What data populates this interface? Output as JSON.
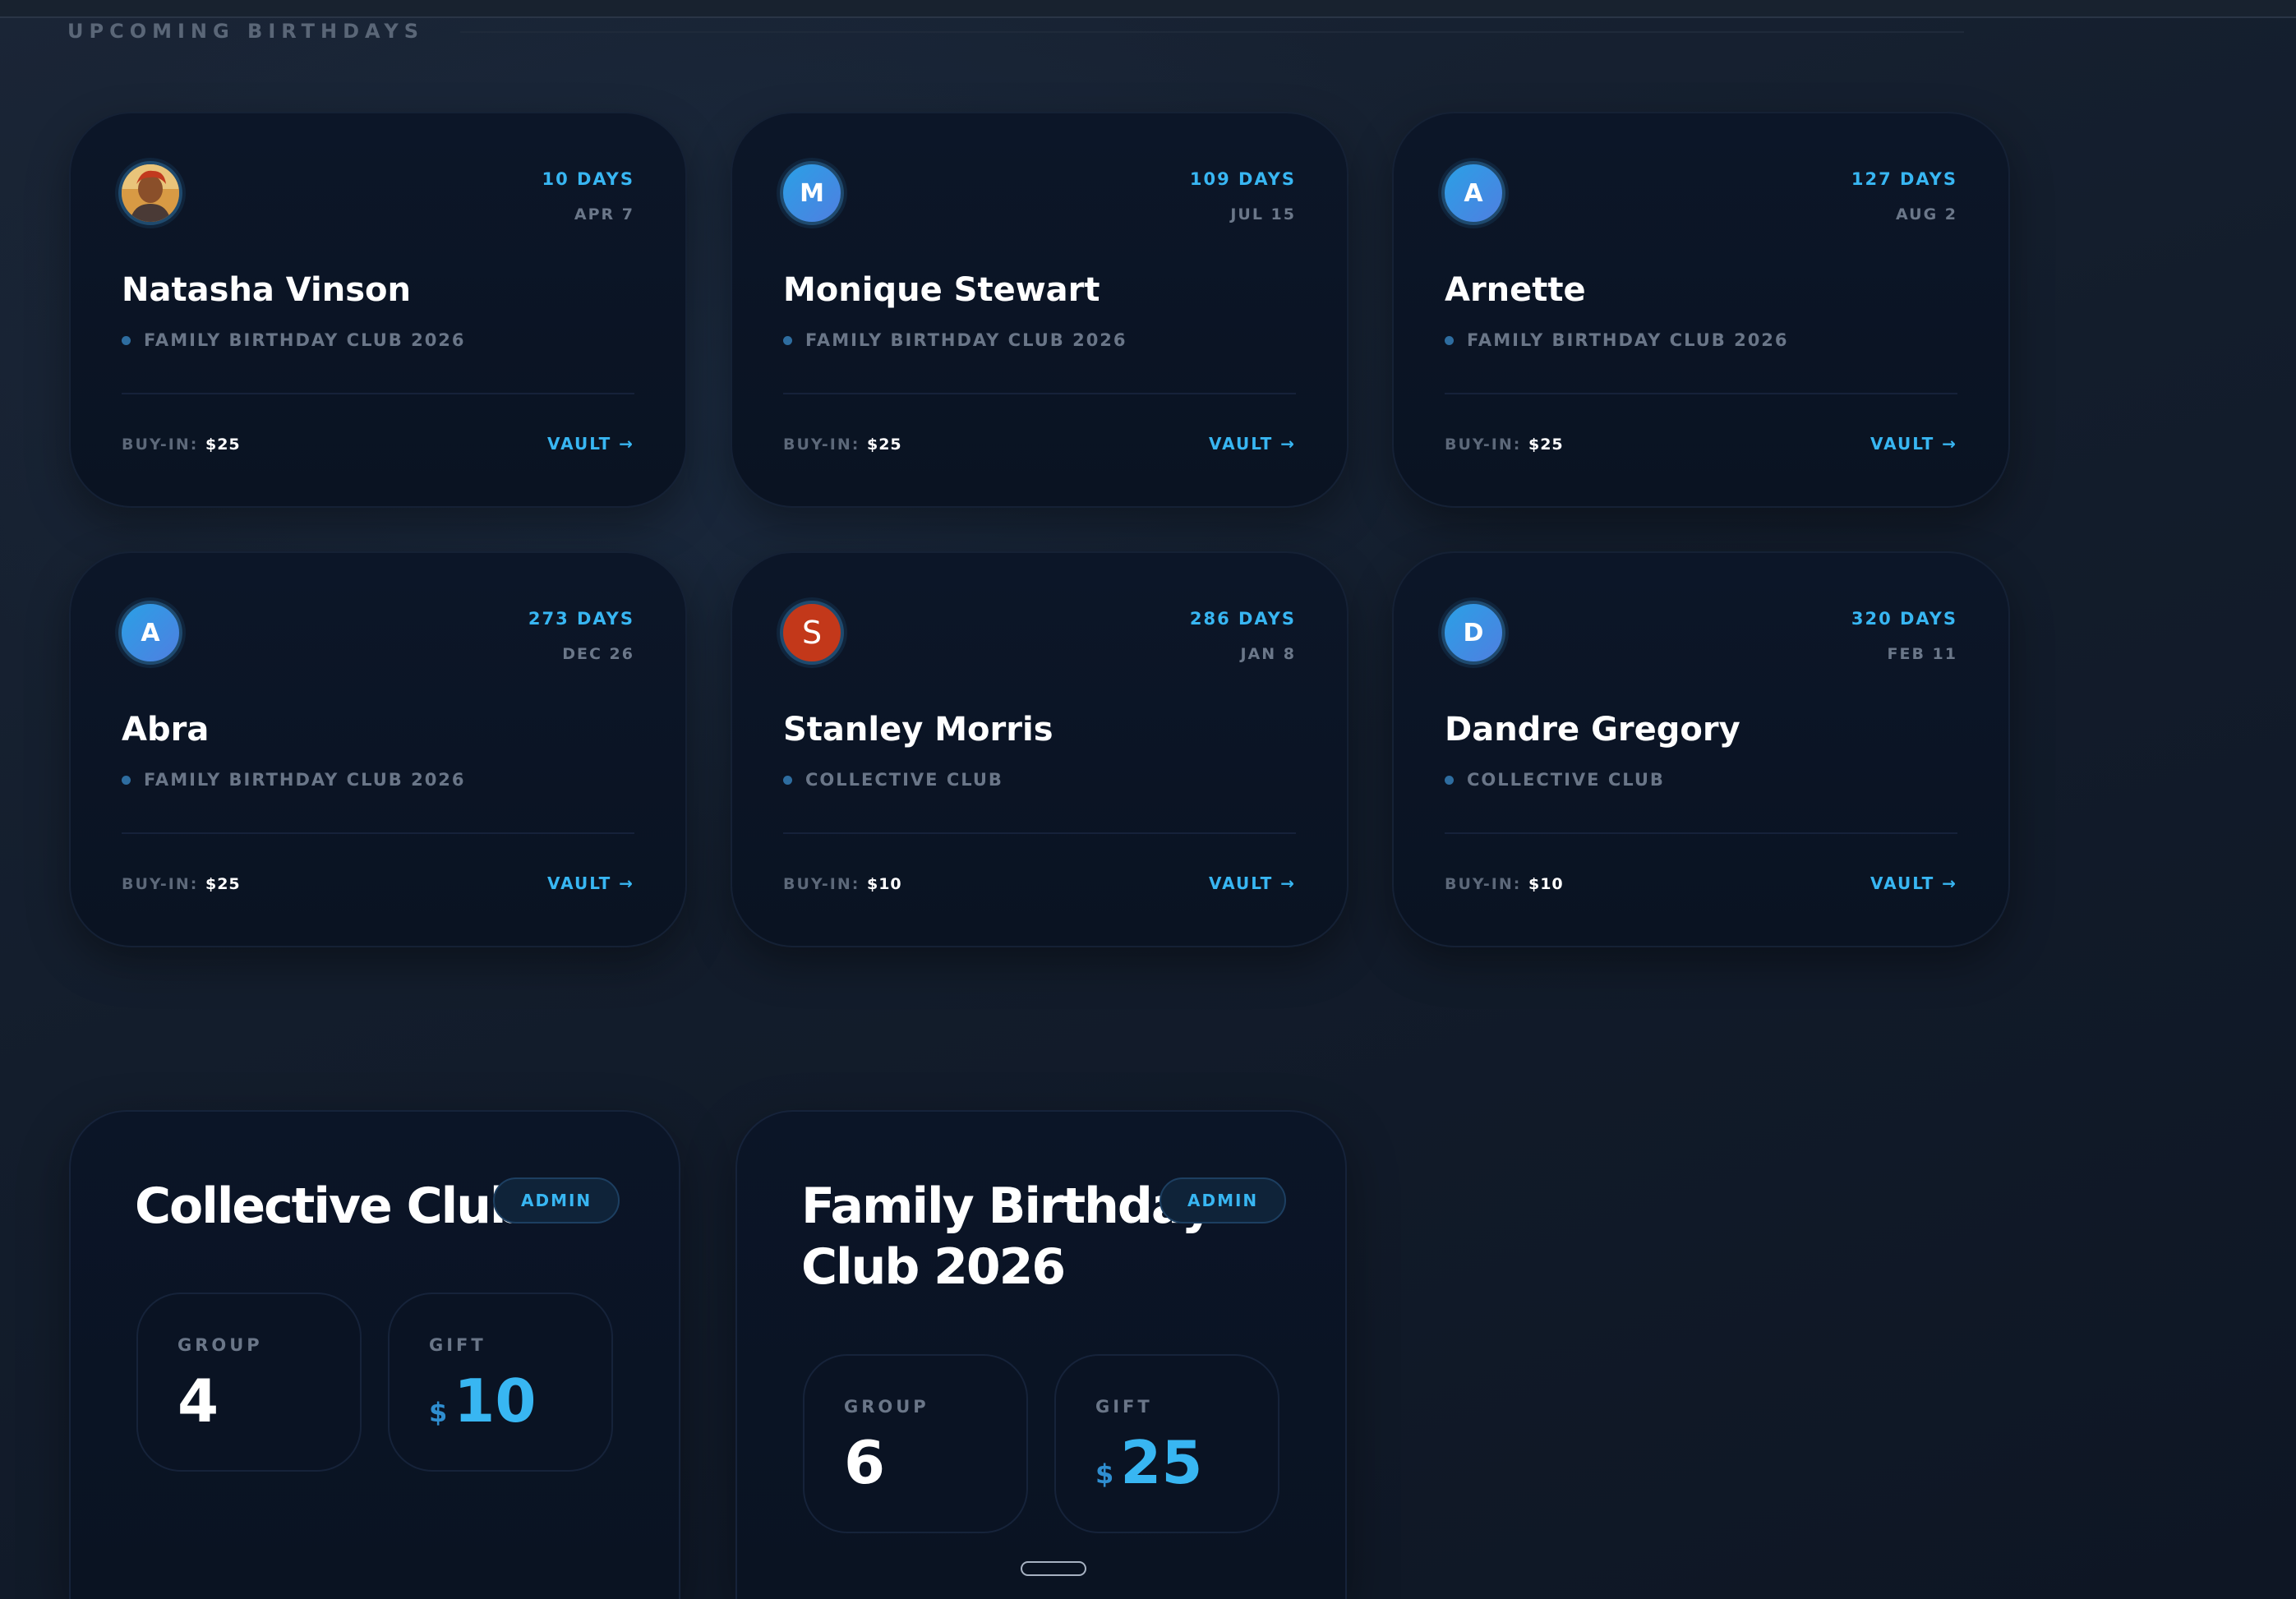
{
  "section": {
    "title": "UPCOMING BIRTHDAYS"
  },
  "birthdays": [
    {
      "name": "Natasha Vinson",
      "days": "10 DAYS",
      "date": "APR 7",
      "club": "FAMILY BIRTHDAY CLUB 2026",
      "buyin_label": "BUY-IN:",
      "buyin_value": "$25",
      "vault_label": "VAULT →",
      "avatar_letter": "",
      "avatar_type": "photo"
    },
    {
      "name": "Monique Stewart",
      "days": "109 DAYS",
      "date": "JUL 15",
      "club": "FAMILY BIRTHDAY CLUB 2026",
      "buyin_label": "BUY-IN:",
      "buyin_value": "$25",
      "vault_label": "VAULT →",
      "avatar_letter": "M",
      "avatar_type": "initial"
    },
    {
      "name": "Arnette",
      "days": "127 DAYS",
      "date": "AUG 2",
      "club": "FAMILY BIRTHDAY CLUB 2026",
      "buyin_label": "BUY-IN:",
      "buyin_value": "$25",
      "vault_label": "VAULT →",
      "avatar_letter": "A",
      "avatar_type": "initial"
    },
    {
      "name": "Abra",
      "days": "273 DAYS",
      "date": "DEC 26",
      "club": "FAMILY BIRTHDAY CLUB 2026",
      "buyin_label": "BUY-IN:",
      "buyin_value": "$25",
      "vault_label": "VAULT →",
      "avatar_letter": "A",
      "avatar_type": "initial"
    },
    {
      "name": "Stanley Morris",
      "days": "286 DAYS",
      "date": "JAN 8",
      "club": "COLLECTIVE CLUB",
      "buyin_label": "BUY-IN:",
      "buyin_value": "$10",
      "vault_label": "VAULT →",
      "avatar_letter": "S",
      "avatar_type": "red"
    },
    {
      "name": "Dandre Gregory",
      "days": "320 DAYS",
      "date": "FEB 11",
      "club": "COLLECTIVE CLUB",
      "buyin_label": "BUY-IN:",
      "buyin_value": "$10",
      "vault_label": "VAULT →",
      "avatar_letter": "D",
      "avatar_type": "initial"
    }
  ],
  "clubs": [
    {
      "title_line1": "Collective Club",
      "title_line2": "",
      "admin_label": "ADMIN",
      "group_label": "GROUP",
      "group_value": "4",
      "gift_label": "GIFT",
      "currency": "$",
      "gift_value": "10"
    },
    {
      "title_line1": "Family Birthday",
      "title_line2": "Club 2026",
      "admin_label": "ADMIN",
      "group_label": "GROUP",
      "group_value": "6",
      "gift_label": "GIFT",
      "currency": "$",
      "gift_value": "25"
    }
  ],
  "colors": {
    "accent": "#38b6f2",
    "background": "#131d2c",
    "card": "#0a1322",
    "avatar_red": "#c3381a"
  }
}
